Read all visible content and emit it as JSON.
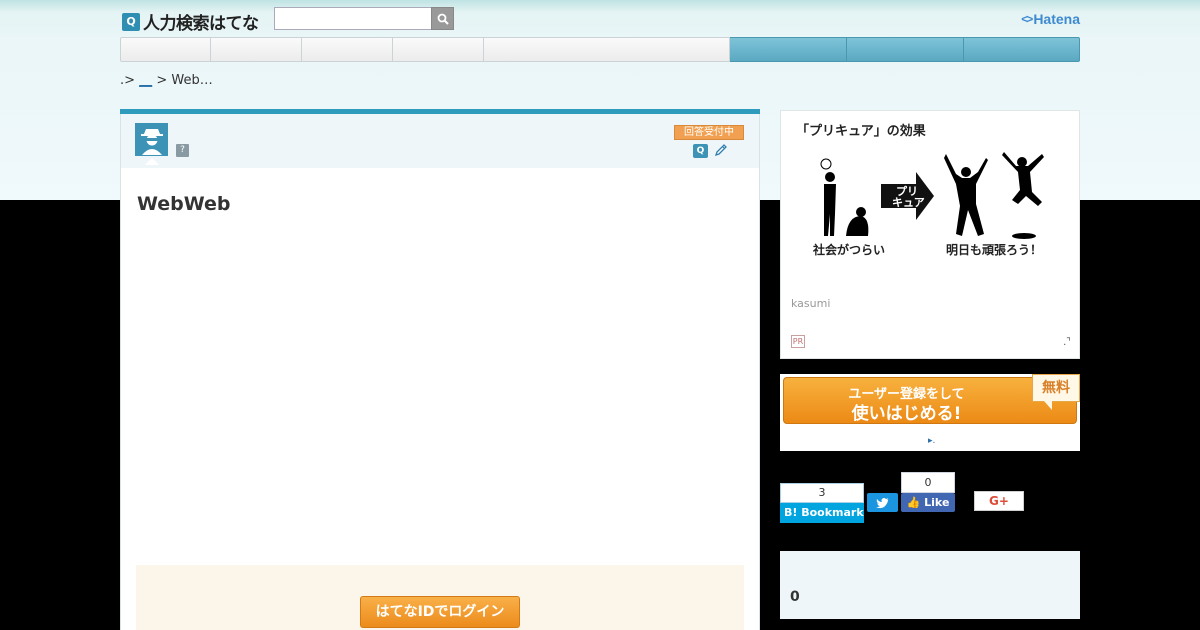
{
  "header": {
    "logo_text": "人力検索はてな",
    "logo_badge": "Q",
    "search_placeholder": "",
    "brand": "Hatena",
    "brand_mark": "<>"
  },
  "nav": {
    "items": [
      {
        "label": "",
        "style": "plain"
      },
      {
        "label": "",
        "style": "plain"
      },
      {
        "label": "",
        "style": "plain"
      },
      {
        "label": "",
        "style": "plain"
      },
      {
        "label": "",
        "style": "plain"
      },
      {
        "label": "",
        "style": "accent"
      },
      {
        "label": "",
        "style": "accent"
      },
      {
        "label": "",
        "style": "accent"
      }
    ]
  },
  "breadcrumb": {
    "prefix": ".>",
    "link": "__",
    "sep": ">",
    "current": "Web…"
  },
  "question": {
    "status": "回答受付中",
    "qa_badge": "Q",
    "help_glyph": "?",
    "title": "WebWeb"
  },
  "login": {
    "button_label": "はてなIDでログイン"
  },
  "ad": {
    "title": "「プリキュア」の効果",
    "arrow_label_1": "プリ",
    "arrow_label_2": "キュア",
    "caption_left": "社会がつらい",
    "caption_right": "明日も頑張ろう！",
    "author": "kasumi",
    "info_glyph": "PR",
    "corner_glyph": ".⌝"
  },
  "register": {
    "line1": "ユーザー登録をして",
    "line2": "使いはじめる!",
    "free_badge": "無料",
    "footer_glyph": "▸."
  },
  "social": {
    "bookmark_count": "3",
    "bookmark_label": "B! Bookmark",
    "twitter_glyph": "🐦",
    "fb_count": "0",
    "fb_label": "Like",
    "gplus_label": "G+"
  },
  "side_count": {
    "value": "0"
  },
  "colors": {
    "accent": "#2f9bbd",
    "orange": "#ec8a16",
    "bookmark": "#00a4de",
    "facebook": "#4267b2",
    "twitter": "#1b95e0"
  }
}
